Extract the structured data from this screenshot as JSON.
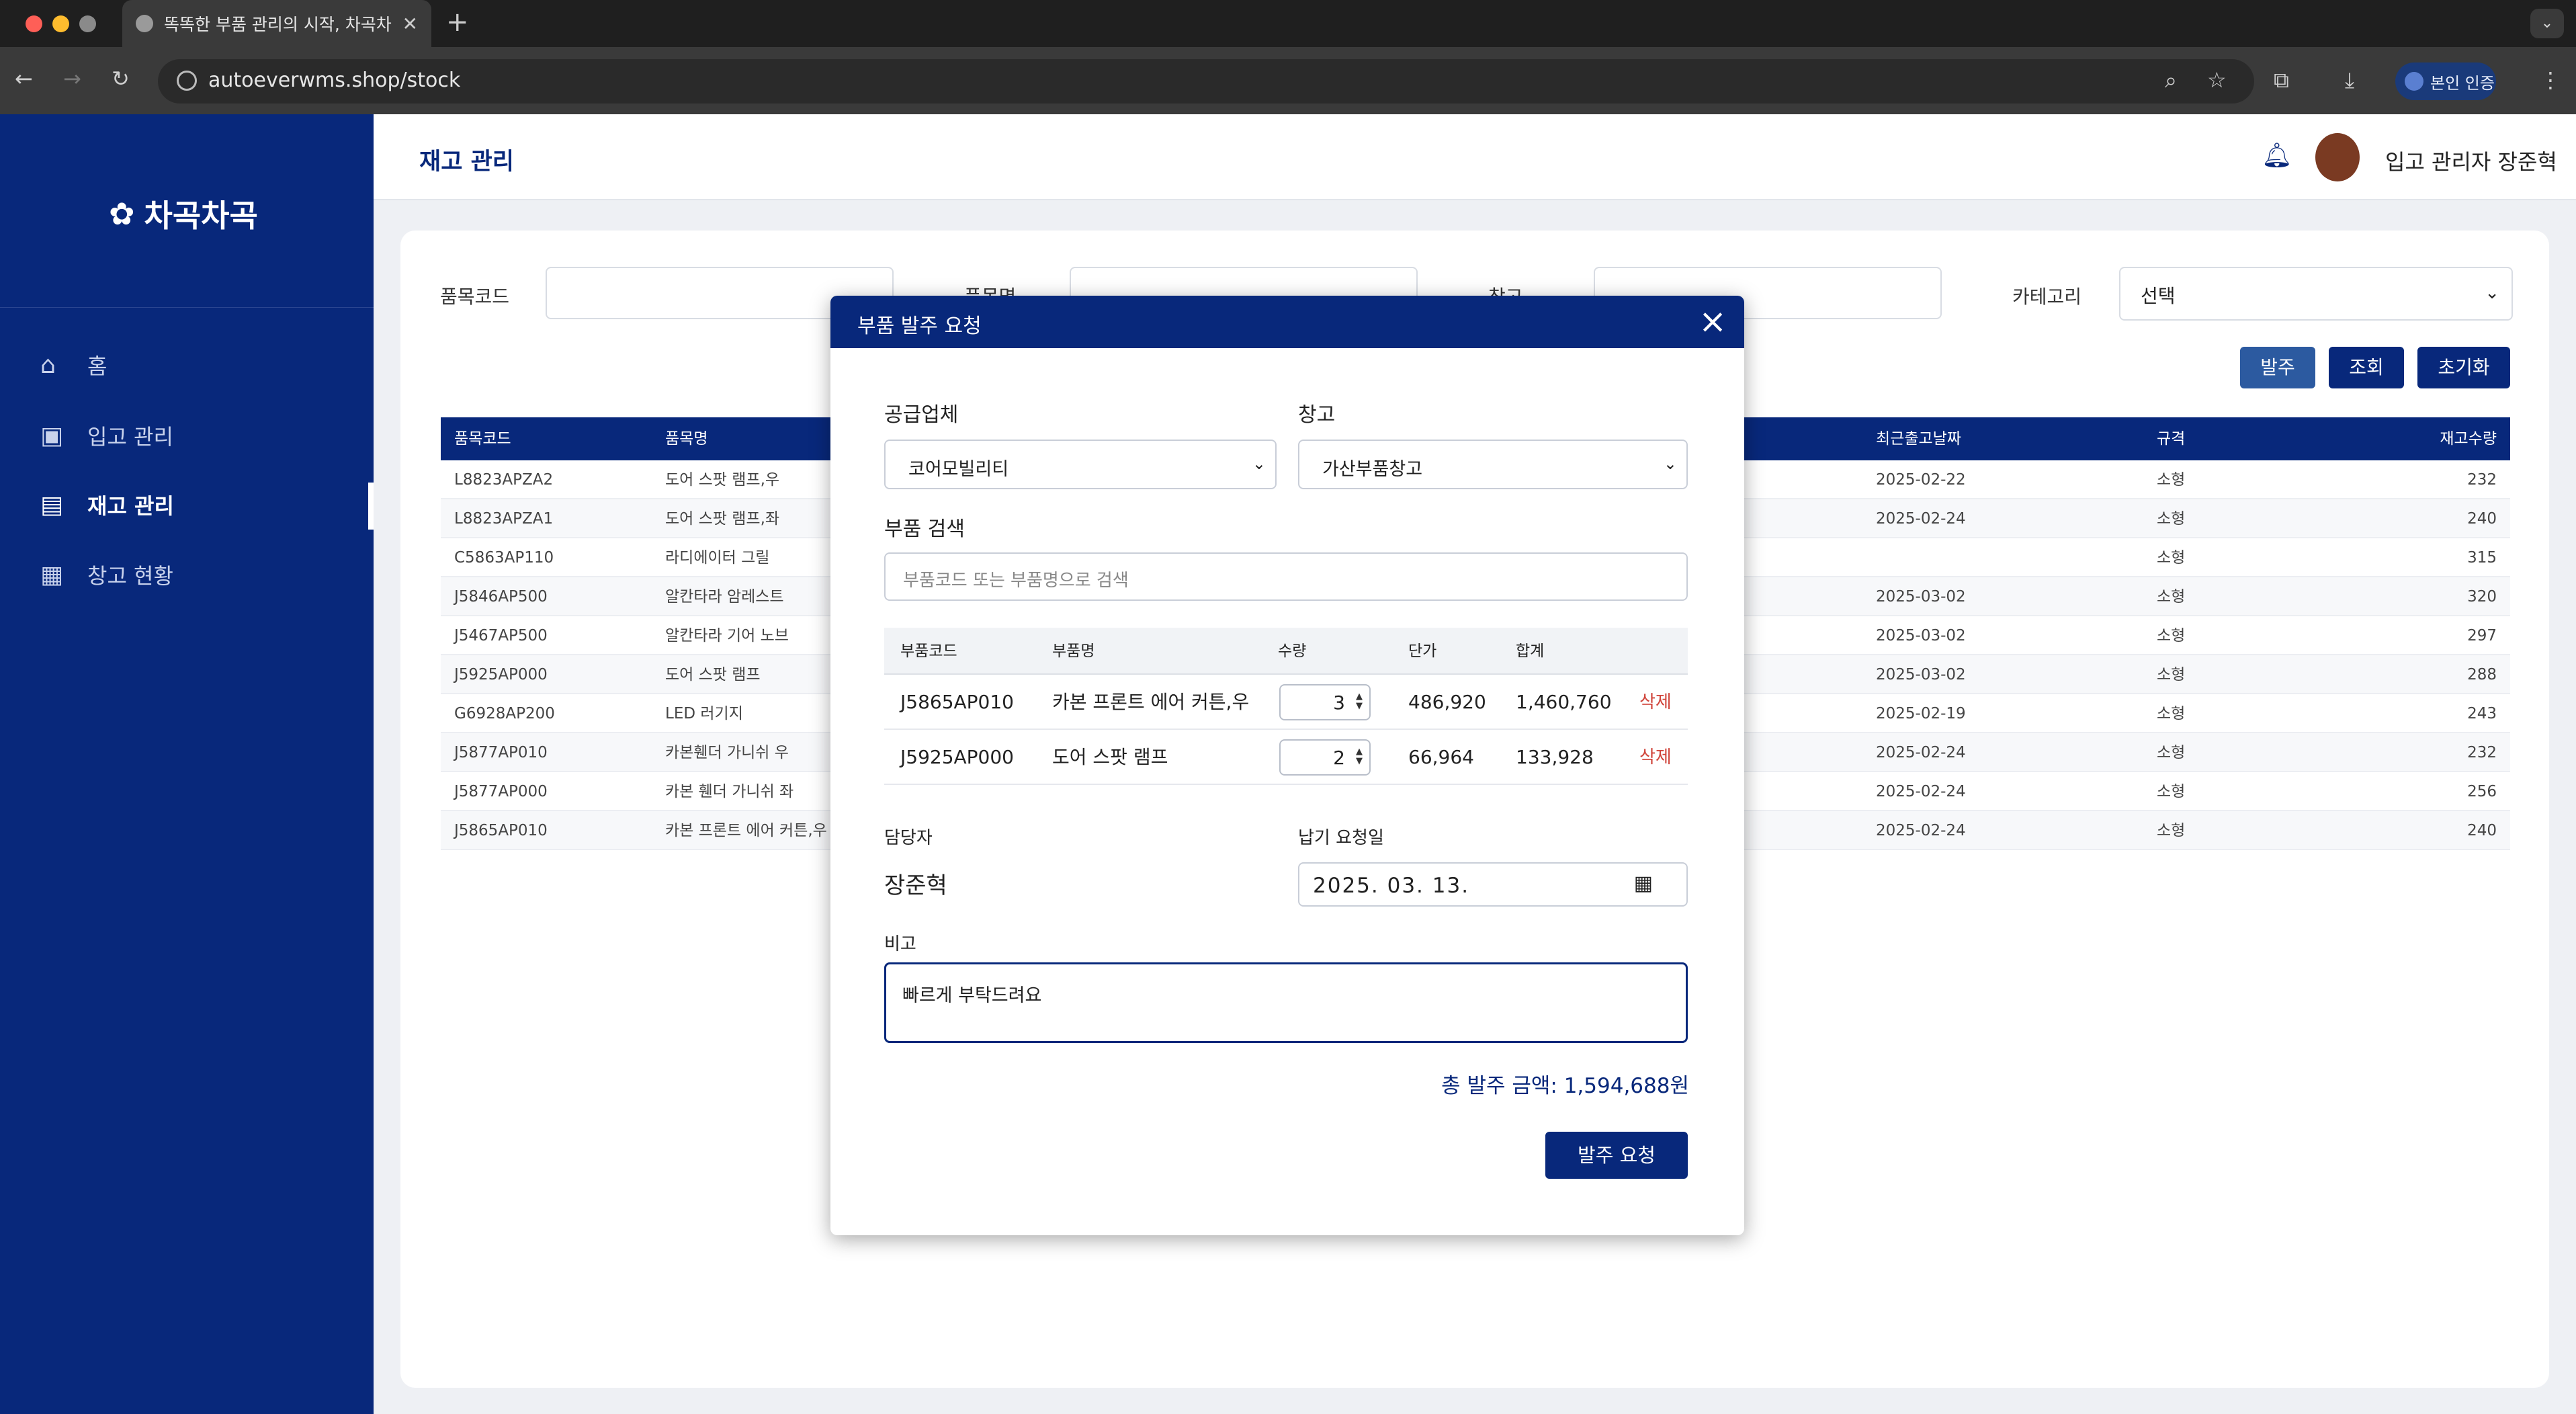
{
  "browser": {
    "tab_title": "똑똑한 부품 관리의 시작, 차곡차곡",
    "url": "autoeverwms.shop/stock",
    "verify_label": "본인 인증"
  },
  "app": {
    "logo": "차곡차곡",
    "nav": [
      {
        "label": "홈",
        "icon": "home-icon"
      },
      {
        "label": "입고 관리",
        "icon": "package-icon"
      },
      {
        "label": "재고 관리",
        "icon": "clipboard-icon",
        "active": true
      },
      {
        "label": "창고 현황",
        "icon": "warehouse-icon"
      }
    ],
    "page_title": "재고 관리",
    "user_name": "입고 관리자 장준혁"
  },
  "filters": {
    "code_label": "품목코드",
    "name_label": "품목명",
    "warehouse_label": "창고",
    "category_label": "카테고리",
    "category_value": "선택",
    "order_button": "발주",
    "search_button": "조회",
    "reset_button": "초기화"
  },
  "stock_table": {
    "headers": [
      "품목코드",
      "품목명",
      "최근출고날짜",
      "규격",
      "재고수량"
    ],
    "rows": [
      [
        "L8823APZA2",
        "도어 스팟 램프,우",
        "2025-02-22",
        "소형",
        "232"
      ],
      [
        "L8823APZA1",
        "도어 스팟 램프,좌",
        "2025-02-24",
        "소형",
        "240"
      ],
      [
        "C5863AP110",
        "라디에이터 그릴",
        "",
        "소형",
        "315"
      ],
      [
        "J5846AP500",
        "알칸타라 암레스트",
        "2025-03-02",
        "소형",
        "320"
      ],
      [
        "J5467AP500",
        "알칸타라 기어 노브",
        "2025-03-02",
        "소형",
        "297"
      ],
      [
        "J5925AP000",
        "도어 스팟 램프",
        "2025-03-02",
        "소형",
        "288"
      ],
      [
        "G6928AP200",
        "LED 러기지",
        "2025-02-19",
        "소형",
        "243"
      ],
      [
        "J5877AP010",
        "카본휀더 가니쉬 우",
        "2025-02-24",
        "소형",
        "232"
      ],
      [
        "J5877AP000",
        "카본 휀더 가니쉬 좌",
        "2025-02-24",
        "소형",
        "256"
      ],
      [
        "J5865AP010",
        "카본 프론트 에어 커튼,우",
        "2025-02-24",
        "소형",
        "240"
      ]
    ]
  },
  "modal": {
    "title": "부품 발주 요청",
    "supplier_label": "공급업체",
    "supplier_value": "코어모빌리티",
    "warehouse_label": "창고",
    "warehouse_value": "가산부품창고",
    "search_label": "부품 검색",
    "search_placeholder": "부품코드 또는 부품명으로 검색",
    "table_headers": [
      "부품코드",
      "부품명",
      "수량",
      "단가",
      "합계"
    ],
    "items": [
      {
        "code": "J5865AP010",
        "name": "카본 프론트 에어 커튼,우",
        "qty": "3",
        "price": "486,920",
        "sum": "1,460,760",
        "delete": "삭제"
      },
      {
        "code": "J5925AP000",
        "name": "도어 스팟 램프",
        "qty": "2",
        "price": "66,964",
        "sum": "133,928",
        "delete": "삭제"
      }
    ],
    "manager_label": "담당자",
    "manager_value": "장준혁",
    "due_label": "납기 요청일",
    "due_value": "2025. 03. 13.",
    "memo_label": "비고",
    "memo_value": "빠르게 부탁드려요",
    "total": "총 발주 금액: 1,594,688원",
    "submit": "발주 요청"
  }
}
